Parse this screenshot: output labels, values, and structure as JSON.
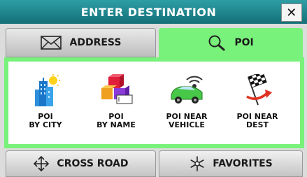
{
  "header": {
    "title": "ENTER DESTINATION",
    "close_glyph": "✕"
  },
  "tabs": [
    {
      "label": "ADDRESS",
      "icon": "envelope-icon",
      "selected": false
    },
    {
      "label": "POI",
      "icon": "magnifier-icon",
      "selected": true
    }
  ],
  "poi_options": [
    {
      "line1": "POI",
      "line2": "BY CITY",
      "icon": "city-buildings-icon"
    },
    {
      "line1": "POI",
      "line2": "BY NAME",
      "icon": "blocks-icon"
    },
    {
      "line1": "POI NEAR",
      "line2": "VEHICLE",
      "icon": "car-signal-icon"
    },
    {
      "line1": "POI NEAR",
      "line2": "DEST",
      "icon": "checkered-flag-icon"
    }
  ],
  "bottom": {
    "cross_road_label": "CROSS ROAD",
    "favorites_label": "FAVORITES"
  },
  "colors": {
    "title_bar": "#1f8a92",
    "selected_tab": "#79f27b",
    "panel_border": "#79f27b"
  }
}
